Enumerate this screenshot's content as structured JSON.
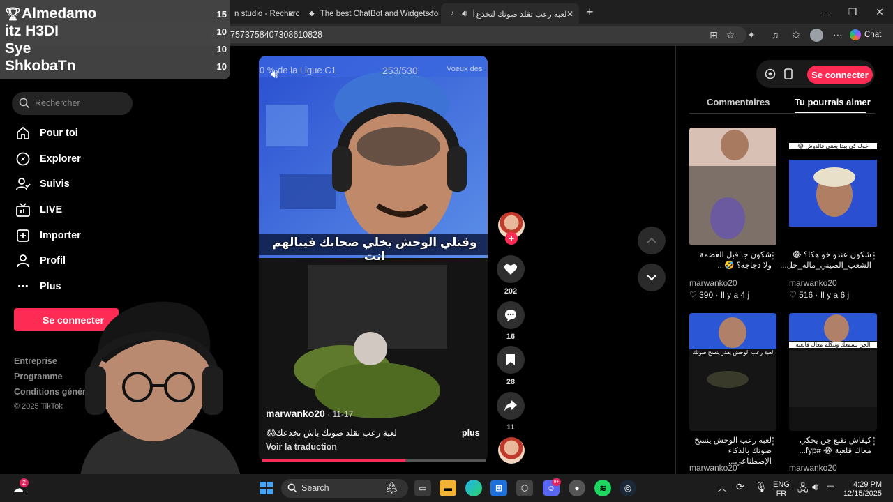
{
  "browser": {
    "tabs": [
      {
        "label": "n studio - Recherch"
      },
      {
        "label": "The best ChatBot and Widgets for"
      },
      {
        "label": "لعبة رعب تقلد صوتك لتخدع أصد"
      }
    ],
    "new_tab": "+",
    "url": "7573758407308610828",
    "chat_label": "Chat"
  },
  "leaderboard": [
    {
      "name": "Almedamo",
      "score": "15"
    },
    {
      "name": "itz H3DI",
      "score": "10"
    },
    {
      "name": "Sye",
      "score": "10"
    },
    {
      "name": "ShkobaTn",
      "score": "10"
    }
  ],
  "sidebar": {
    "search_placeholder": "Rechercher",
    "nav": [
      {
        "label": "Pour toi",
        "icon": "home-icon"
      },
      {
        "label": "Explorer",
        "icon": "compass-icon"
      },
      {
        "label": "Suivis",
        "icon": "following-icon"
      },
      {
        "label": "LIVE",
        "icon": "live-icon"
      },
      {
        "label": "Importer",
        "icon": "upload-icon"
      },
      {
        "label": "Profil",
        "icon": "profile-icon"
      },
      {
        "label": "Plus",
        "icon": "more-icon"
      }
    ],
    "login_button": "Se connecter",
    "footer_links": [
      "Entreprise",
      "Programme",
      "Conditions générales"
    ],
    "copyright": "© 2025 TikTok"
  },
  "video": {
    "top_overlay_left": "0 % de la Ligue C1",
    "top_overlay_mid": "253/530",
    "top_overlay_right": "Voeux des",
    "subtitle": "وقتلي الوحش يخلي صحابك فيبالهم انت",
    "author": "marwanko20",
    "date": " · 11-17",
    "caption": "لعبة رعب تقلد صوتك باش تخدعك😱...",
    "more_label": "plus",
    "translate_label": "Voir la traduction",
    "progress": 0.64
  },
  "actions": {
    "likes": "202",
    "comments": "16",
    "saves": "28",
    "shares": "11"
  },
  "right_panel": {
    "connect_button": "Se connecter",
    "tab_comments": "Commentaires",
    "tab_suggest": "Tu pourrais aimer",
    "cards": [
      {
        "title": "شكون جا قبل العضمة ولا دجاجة؟ 🤣...",
        "author": "marwanko20",
        "likes": "390",
        "age": "Il y a 4 j"
      },
      {
        "title": "شكون عندو خو هكا؟ 😂 الشعب_الصيني_ماله_حل...",
        "author": "marwanko20",
        "likes": "516",
        "age": "Il y a 6 j",
        "thumb_text": "خوك كي يبدا يغنني فالدوش 😂"
      },
      {
        "title": "لعبة رعب الوحش ينسخ صوتك بالذكاء الإصطناعي...",
        "author": "marwanko20",
        "thumb_text": "لعبة رعب الوحش يقدر ينسخ صوتك"
      },
      {
        "title": "كيفاش تقنع جن يحكي معاك قلعبة 😂 #fyp...",
        "author": "marwanko20",
        "thumb_text": "الجن يسمعك ويتكلم معاك فالعبة"
      }
    ]
  },
  "taskbar": {
    "search_label": "Search",
    "badge_count": "2",
    "discord_badge": "9+",
    "lang_top": "ENG",
    "lang_bottom": "FR",
    "time": "4:29 PM",
    "date": "12/15/2025"
  }
}
